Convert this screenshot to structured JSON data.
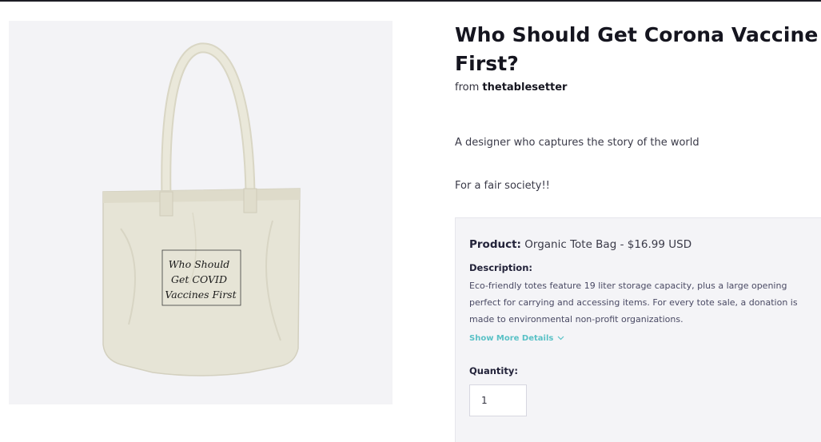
{
  "product": {
    "title": "Who Should Get Corona Vaccine First?",
    "from_prefix": "from",
    "creator": "thetablesetter",
    "description_lines": [
      "A designer who captures the story of the world",
      "For a fair society!!"
    ]
  },
  "design_print": {
    "lines": [
      "Who Should",
      "Get COVID",
      "Vaccines First"
    ]
  },
  "details": {
    "product_label": "Product:",
    "product_value": "Organic Tote Bag - $16.99 USD",
    "description_label": "Description:",
    "description_text": "Eco-friendly totes feature 19 liter storage capacity, plus a large opening perfect for carrying and accessing items. For every tote sale, a donation is made to environmental non-profit organizations.",
    "show_more_label": "Show More Details",
    "quantity_label": "Quantity:",
    "quantity_value": "1"
  },
  "colors": {
    "accent": "#59c1c6",
    "bag": "#e6e4d6",
    "panel": "#f3f3f6"
  },
  "icons": {
    "show_more": "chevron-down-icon"
  }
}
